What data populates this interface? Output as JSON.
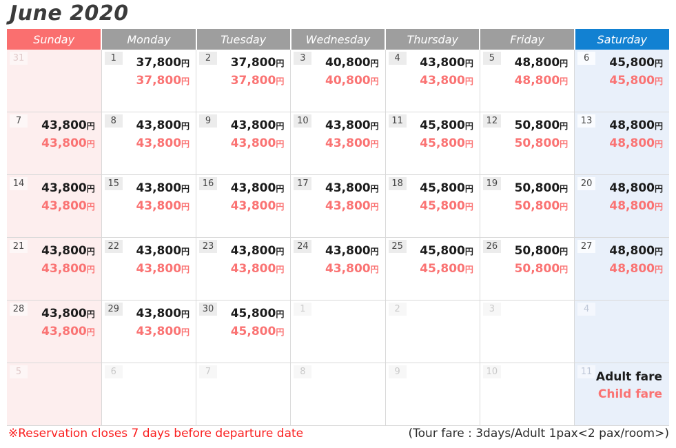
{
  "title": "June 2020",
  "currency_symbol": "円",
  "colors": {
    "sunday_header": "#fa6f6f",
    "saturday_header": "#1281d2",
    "weekday_header": "#9e9e9e",
    "adult_price": "#1c1c1c",
    "child_price": "#fa7373",
    "sunday_cell": "#fdeeee",
    "saturday_cell": "#e9f0fa",
    "footer_note": "#fa2020"
  },
  "weekdays": [
    {
      "label": "Sunday",
      "kind": "sun"
    },
    {
      "label": "Monday",
      "kind": "weekday"
    },
    {
      "label": "Tuesday",
      "kind": "weekday"
    },
    {
      "label": "Wednesday",
      "kind": "weekday"
    },
    {
      "label": "Thursday",
      "kind": "weekday"
    },
    {
      "label": "Friday",
      "kind": "weekday"
    },
    {
      "label": "Saturday",
      "kind": "sat"
    }
  ],
  "legend": {
    "adult_label": "Adult fare",
    "child_label": "Child fare"
  },
  "footer": {
    "note": "※Reservation closes 7 days before departure date",
    "tour_fare": "(Tour fare : 3days/Adult 1pax<2 pax/room>)"
  },
  "weeks": [
    [
      {
        "day": "31",
        "other": true,
        "adult": "",
        "child": ""
      },
      {
        "day": "1",
        "other": false,
        "adult": "37,800",
        "child": "37,800"
      },
      {
        "day": "2",
        "other": false,
        "adult": "37,800",
        "child": "37,800"
      },
      {
        "day": "3",
        "other": false,
        "adult": "40,800",
        "child": "40,800"
      },
      {
        "day": "4",
        "other": false,
        "adult": "43,800",
        "child": "43,800"
      },
      {
        "day": "5",
        "other": false,
        "adult": "48,800",
        "child": "48,800"
      },
      {
        "day": "6",
        "other": false,
        "adult": "45,800",
        "child": "45,800"
      }
    ],
    [
      {
        "day": "7",
        "other": false,
        "adult": "43,800",
        "child": "43,800"
      },
      {
        "day": "8",
        "other": false,
        "adult": "43,800",
        "child": "43,800"
      },
      {
        "day": "9",
        "other": false,
        "adult": "43,800",
        "child": "43,800"
      },
      {
        "day": "10",
        "other": false,
        "adult": "43,800",
        "child": "43,800"
      },
      {
        "day": "11",
        "other": false,
        "adult": "45,800",
        "child": "45,800"
      },
      {
        "day": "12",
        "other": false,
        "adult": "50,800",
        "child": "50,800"
      },
      {
        "day": "13",
        "other": false,
        "adult": "48,800",
        "child": "48,800"
      }
    ],
    [
      {
        "day": "14",
        "other": false,
        "adult": "43,800",
        "child": "43,800"
      },
      {
        "day": "15",
        "other": false,
        "adult": "43,800",
        "child": "43,800"
      },
      {
        "day": "16",
        "other": false,
        "adult": "43,800",
        "child": "43,800"
      },
      {
        "day": "17",
        "other": false,
        "adult": "43,800",
        "child": "43,800"
      },
      {
        "day": "18",
        "other": false,
        "adult": "45,800",
        "child": "45,800"
      },
      {
        "day": "19",
        "other": false,
        "adult": "50,800",
        "child": "50,800"
      },
      {
        "day": "20",
        "other": false,
        "adult": "48,800",
        "child": "48,800"
      }
    ],
    [
      {
        "day": "21",
        "other": false,
        "adult": "43,800",
        "child": "43,800"
      },
      {
        "day": "22",
        "other": false,
        "adult": "43,800",
        "child": "43,800"
      },
      {
        "day": "23",
        "other": false,
        "adult": "43,800",
        "child": "43,800"
      },
      {
        "day": "24",
        "other": false,
        "adult": "43,800",
        "child": "43,800"
      },
      {
        "day": "25",
        "other": false,
        "adult": "45,800",
        "child": "45,800"
      },
      {
        "day": "26",
        "other": false,
        "adult": "50,800",
        "child": "50,800"
      },
      {
        "day": "27",
        "other": false,
        "adult": "48,800",
        "child": "48,800"
      }
    ],
    [
      {
        "day": "28",
        "other": false,
        "adult": "43,800",
        "child": "43,800"
      },
      {
        "day": "29",
        "other": false,
        "adult": "43,800",
        "child": "43,800"
      },
      {
        "day": "30",
        "other": false,
        "adult": "45,800",
        "child": "45,800"
      },
      {
        "day": "1",
        "other": true,
        "adult": "",
        "child": ""
      },
      {
        "day": "2",
        "other": true,
        "adult": "",
        "child": ""
      },
      {
        "day": "3",
        "other": true,
        "adult": "",
        "child": ""
      },
      {
        "day": "4",
        "other": true,
        "adult": "",
        "child": ""
      }
    ],
    [
      {
        "day": "5",
        "other": true,
        "adult": "",
        "child": ""
      },
      {
        "day": "6",
        "other": true,
        "adult": "",
        "child": ""
      },
      {
        "day": "7",
        "other": true,
        "adult": "",
        "child": ""
      },
      {
        "day": "8",
        "other": true,
        "adult": "",
        "child": ""
      },
      {
        "day": "9",
        "other": true,
        "adult": "",
        "child": ""
      },
      {
        "day": "10",
        "other": true,
        "adult": "",
        "child": ""
      },
      {
        "day": "11",
        "other": true,
        "adult": "",
        "child": "",
        "legend": true
      }
    ]
  ]
}
